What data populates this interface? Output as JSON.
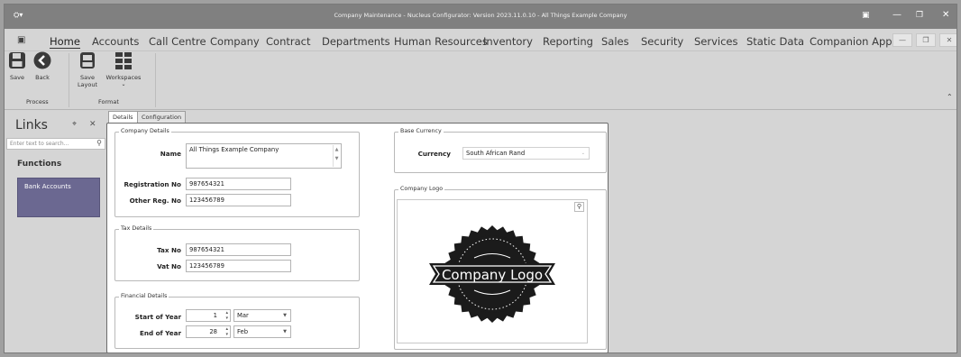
{
  "app": {
    "title": "Company Maintenance - Nucleus Configurator: Version 2023.11.0.10 - All Things Example Company"
  },
  "menu": {
    "items": [
      "Home",
      "Accounts",
      "Call Centre",
      "Company",
      "Contract",
      "Departments",
      "Human Resources",
      "Inventory",
      "Reporting",
      "Sales",
      "Security",
      "Services",
      "Static Data",
      "Companion Apps"
    ]
  },
  "ribbon": {
    "save": "Save",
    "back": "Back",
    "save_layout": "Save Layout",
    "workspaces": "Workspaces",
    "group_process": "Process",
    "group_format": "Format"
  },
  "links": {
    "title": "Links",
    "search_placeholder": "Enter text to search...",
    "functions_title": "Functions",
    "items": [
      "Bank Accounts"
    ]
  },
  "tabs": {
    "details": "Details",
    "configuration": "Configuration"
  },
  "company_details": {
    "caption": "Company Details",
    "name_label": "Name",
    "name_value": "All Things Example Company",
    "reg_label": "Registration No",
    "reg_value": "987654321",
    "other_label": "Other Reg. No",
    "other_value": "123456789"
  },
  "tax_details": {
    "caption": "Tax Details",
    "tax_label": "Tax No",
    "tax_value": "987654321",
    "vat_label": "Vat No",
    "vat_value": "123456789"
  },
  "financial_details": {
    "caption": "Financial Details",
    "start_label": "Start of Year",
    "start_day": "1",
    "start_month": "Mar",
    "end_label": "End of Year",
    "end_day": "28",
    "end_month": "Feb"
  },
  "base_currency": {
    "caption": "Base Currency",
    "currency_label": "Currency",
    "currency_value": "South African Rand"
  },
  "company_logo": {
    "caption": "Company Logo",
    "logo_text": "Company Logo"
  },
  "colors": {
    "accent_tile": "#6b6891",
    "titlebar": "#808080",
    "window": "#d5d5d5"
  }
}
